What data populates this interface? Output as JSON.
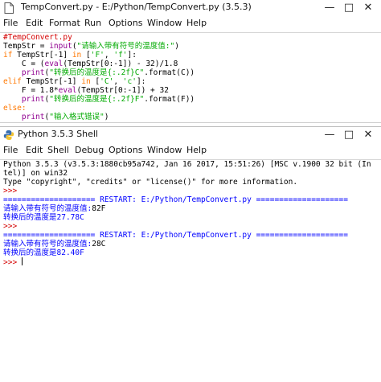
{
  "editor_window": {
    "title": "TempConvert.py - E:/Python/TempConvert.py (3.5.3)",
    "controls": [
      "—",
      "□",
      "✕"
    ],
    "menu": [
      "File",
      "Edit",
      "Format",
      "Run",
      "Options",
      "Window",
      "Help"
    ]
  },
  "shell_window": {
    "title": "Python 3.5.3 Shell",
    "controls": [
      "—",
      "□",
      "✕"
    ],
    "menu": [
      "File",
      "Edit",
      "Shell",
      "Debug",
      "Options",
      "Window",
      "Help"
    ]
  },
  "code": {
    "l1": "#TempConvert.py",
    "l2a": "TempStr = ",
    "l2b": "input",
    "l2c": "(",
    "l2d": "\"请输入带有符号的温度值:\"",
    "l2e": ")",
    "l3a": "if",
    "l3b": " TempStr[-1] ",
    "l3c": "in",
    "l3d": " [",
    "l3e": "'F'",
    "l3f": ", ",
    "l3g": "'f'",
    "l3h": "]:",
    "l4a": "    C = (",
    "l4b": "eval",
    "l4c": "(TempStr[0:-1]) - 32)/1.8",
    "l5a": "    ",
    "l5b": "print",
    "l5c": "(",
    "l5d": "\"转换后的温度是{:.2f}C\"",
    "l5e": ".format(C))",
    "l6a": "elif",
    "l6b": " TempStr[-1] ",
    "l6c": "in",
    "l6d": " [",
    "l6e": "'C'",
    "l6f": ", ",
    "l6g": "'c'",
    "l6h": "]:",
    "l7a": "    F = 1.8*",
    "l7b": "eval",
    "l7c": "(TempStr[0:-1]) + 32",
    "l8a": "    ",
    "l8b": "print",
    "l8c": "(",
    "l8d": "\"转换后的温度是{:.2f}F\"",
    "l8e": ".format(F))",
    "l9": "else:",
    "l10a": "    ",
    "l10b": "print",
    "l10c": "(",
    "l10d": "\"输入格式错误\"",
    "l10e": ")"
  },
  "shell": {
    "banner1": "Python 3.5.3 (v3.5.3:1880cb95a742, Jan 16 2017, 15:51:26) [MSC v.1900 32 bit (In",
    "banner2": "tel)] on win32",
    "banner3": "Type \"copyright\", \"credits\" or \"license()\" for more information.",
    "prompt": ">>>",
    "restart": "==================== RESTART: E:/Python/TempConvert.py ====================",
    "run1_prompt": "请输入带有符号的温度值:",
    "run1_input": "82F",
    "run1_output": "转换后的温度是27.78C",
    "run2_prompt": "请输入带有符号的温度值:",
    "run2_input": "28C",
    "run2_output": "转换后的温度是82.40F"
  }
}
